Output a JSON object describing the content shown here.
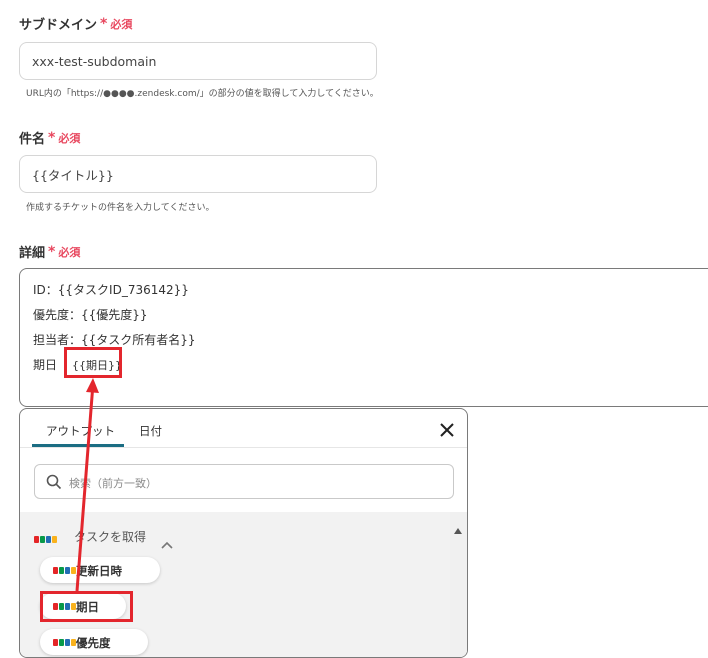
{
  "fields": {
    "subdomain": {
      "label": "サブドメイン",
      "required_star": "*",
      "required_text": "必須",
      "value": "xxx-test-subdomain",
      "hint": "URL内の「https://●●●●.zendesk.com/」の部分の値を取得して入力してください。"
    },
    "subject": {
      "label": "件名",
      "required_star": "*",
      "required_text": "必須",
      "value": "{{タイトル}}",
      "hint": "作成するチケットの件名を入力してください。"
    },
    "detail": {
      "label": "詳細",
      "required_star": "*",
      "required_text": "必須",
      "lines": [
        "ID：{{タスクID_736142}}",
        "優先度：{{優先度}}",
        "担当者：{{タスク所有者名}}"
      ],
      "due_label": "期日",
      "due_token": "{{期日}}"
    }
  },
  "panel": {
    "tabs": [
      "アウトプット",
      "日付"
    ],
    "search_placeholder": "検索（前方一致）",
    "group_label": "タスクを取得",
    "items": [
      "更新日時",
      "期日",
      "優先度"
    ]
  },
  "icons": {
    "close": "close-icon",
    "search": "search-icon",
    "collapse": "chevron-up-icon",
    "app": "zoho-logo-icon",
    "scroll_up": "scroll-up-arrow-icon"
  },
  "colors": {
    "required": "#e8485f",
    "tab_active": "#1b6d83",
    "highlight": "#e3262d"
  }
}
